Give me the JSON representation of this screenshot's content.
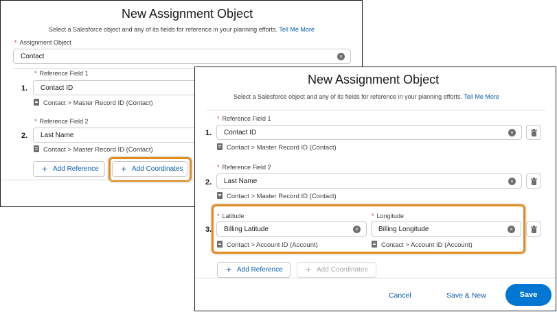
{
  "back_panel": {
    "title": "New Assignment Object",
    "subtitle": "Select a Salesforce object and any of its fields for reference in your planning efforts.",
    "tell_me_more": "Tell Me More",
    "assignment_object": {
      "label": "Assignment Object",
      "value": "Contact"
    },
    "references": [
      {
        "number": "1.",
        "label": "Reference Field 1",
        "value": "Contact ID",
        "path": "Contact > Master Record ID (Contact)"
      },
      {
        "number": "2.",
        "label": "Reference Field 2",
        "value": "Last Name",
        "path": "Contact > Master Record ID (Contact)"
      }
    ],
    "add_reference": "Add Reference",
    "add_coordinates": "Add Coordinates"
  },
  "front_panel": {
    "title": "New Assignment Object",
    "subtitle": "Select a Salesforce object and any of its fields for reference in your planning efforts.",
    "tell_me_more": "Tell Me More",
    "references": [
      {
        "number": "1.",
        "label": "Reference Field 1",
        "value": "Contact ID",
        "path": "Contact > Master Record ID (Contact)"
      },
      {
        "number": "2.",
        "label": "Reference Field 2",
        "value": "Last Name",
        "path": "Contact > Master Record ID (Contact)"
      }
    ],
    "coordinates": {
      "number": "3.",
      "latitude": {
        "label": "Latitude",
        "value": "Billing Latitude",
        "path": "Contact > Account ID (Account)"
      },
      "longitude": {
        "label": "Longitude",
        "value": "Billing Longitude",
        "path": "Contact > Account ID (Account)"
      }
    },
    "add_reference": "Add Reference",
    "add_coordinates": "Add Coordinates",
    "footer": {
      "cancel": "Cancel",
      "save_new": "Save & New",
      "save": "Save"
    }
  },
  "icons": {
    "clear": "clear-icon",
    "delete": "trash-icon",
    "plus": "plus-icon",
    "field": "field-icon"
  },
  "colors": {
    "accent": "#0176d3",
    "link": "#0b5cab",
    "highlight": "#e38b1b",
    "required": "#c23934"
  }
}
